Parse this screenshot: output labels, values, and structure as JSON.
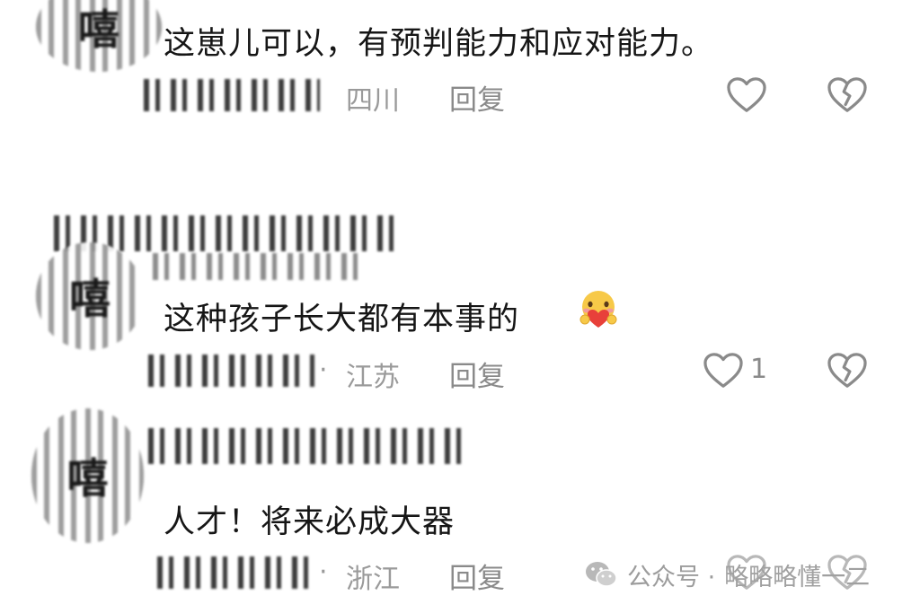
{
  "comments": [
    {
      "text": "这崽儿可以，有预判能力和应对能力。",
      "location": "四川",
      "reply": "回复",
      "likes": ""
    },
    {
      "text": "这种孩子长大都有本事的",
      "emoji": "hugging-face-with-heart-emoji",
      "location": "江苏",
      "location_separator": "·",
      "reply": "回复",
      "likes": "1"
    },
    {
      "text": "人才！将来必成大器",
      "location": "浙江",
      "location_separator": "·",
      "reply": "回复",
      "likes": ""
    }
  ],
  "avatar_glyph": "嘻",
  "watermark": {
    "prefix": "公众号 ·",
    "account": "略略略懂一二"
  },
  "colors": {
    "text": "#161616",
    "meta": "#9a9a9a",
    "icon": "#8a8a8a",
    "emoji_face": "#f7c948",
    "emoji_heart": "#e8403a"
  }
}
